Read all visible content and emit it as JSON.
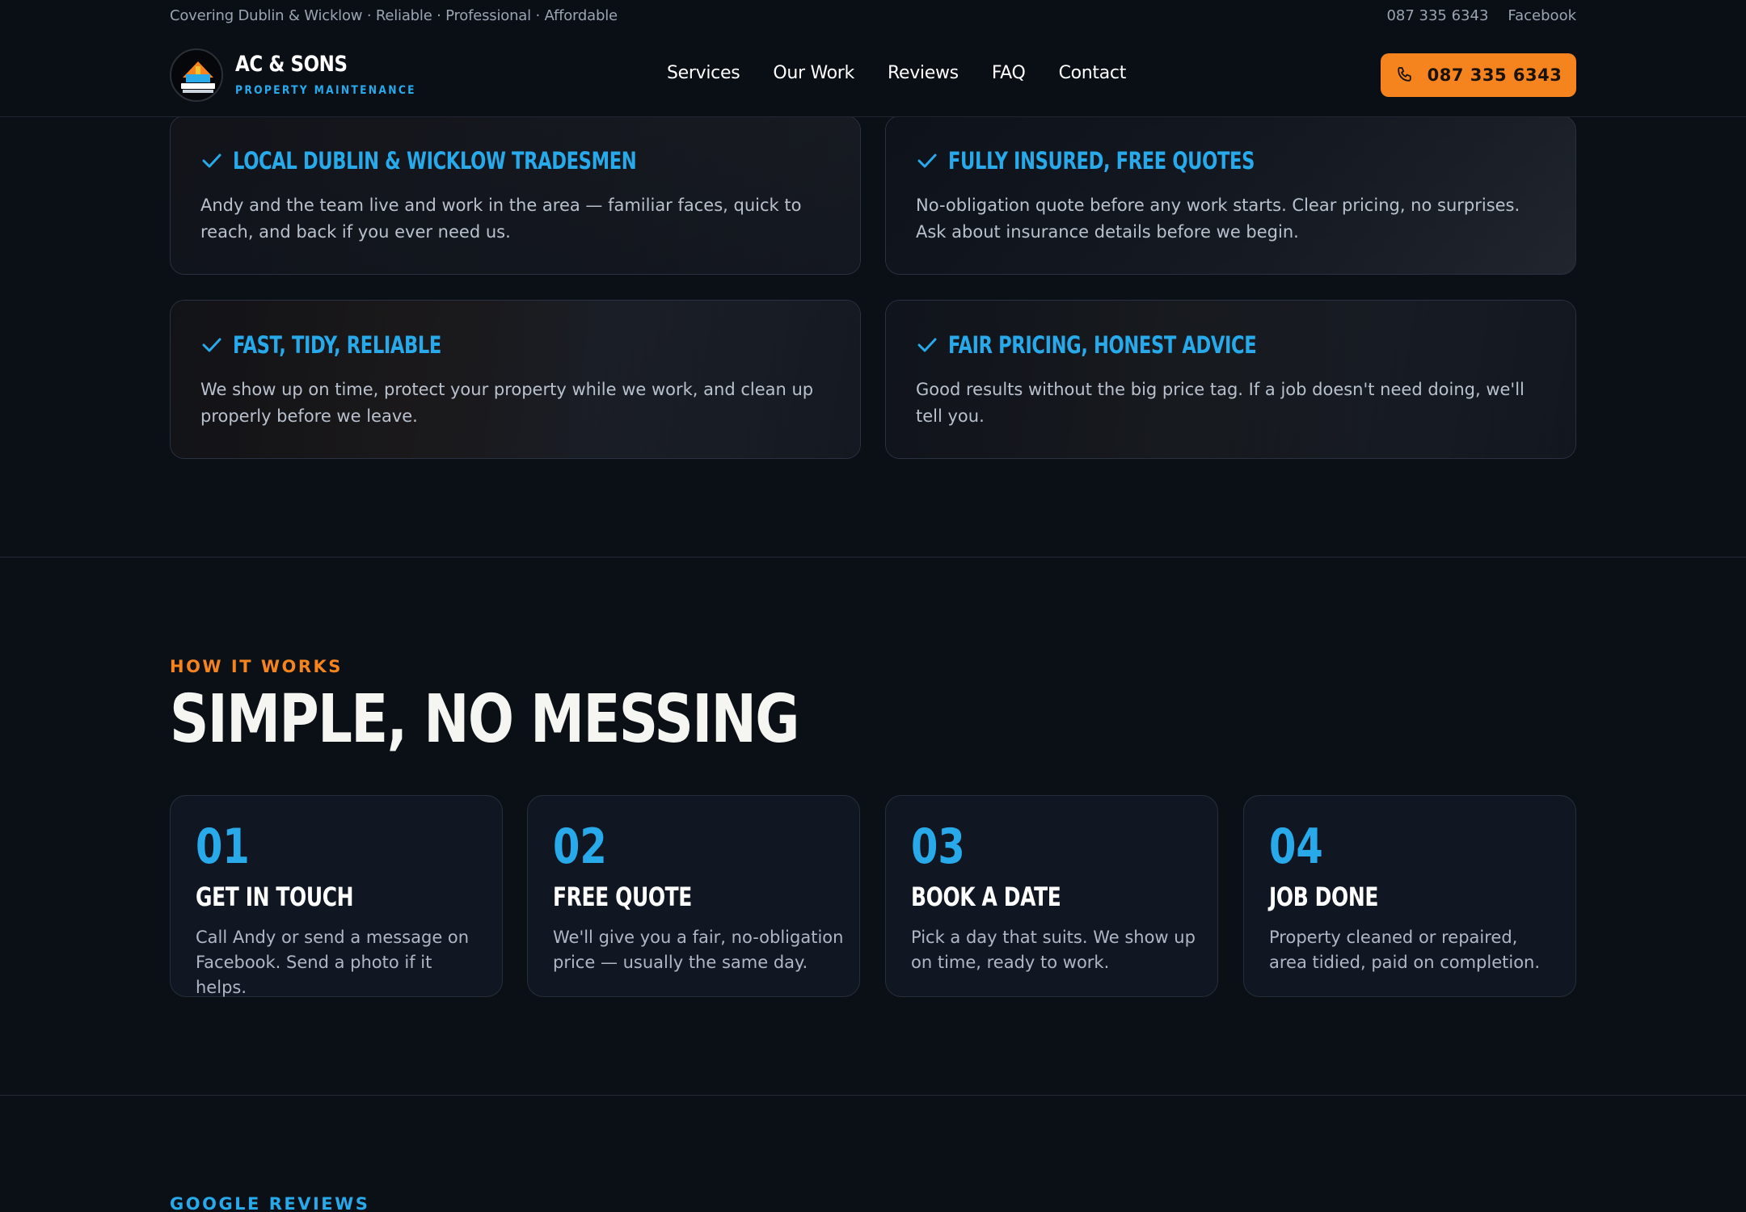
{
  "topbar": {
    "tagline": "Covering Dublin & Wicklow · Reliable · Professional · Affordable",
    "phone": "087 335 6343",
    "facebook": "Facebook"
  },
  "header": {
    "brand_name": "AC & SONS",
    "brand_sub": "PROPERTY MAINTENANCE",
    "nav": [
      "Services",
      "Our Work",
      "Reviews",
      "FAQ",
      "Contact"
    ],
    "call_button": "087 335 6343"
  },
  "features": [
    {
      "title": "LOCAL DUBLIN & WICKLOW TRADESMEN",
      "desc": "Andy and the team live and work in the area — familiar faces, quick to reach, and back if you ever need us."
    },
    {
      "title": "FULLY INSURED, FREE QUOTES",
      "desc": "No-obligation quote before any work starts. Clear pricing, no surprises. Ask about insurance details before we begin."
    },
    {
      "title": "FAST, TIDY, RELIABLE",
      "desc": "We show up on time, protect your property while we work, and clean up properly before we leave."
    },
    {
      "title": "FAIR PRICING, HONEST ADVICE",
      "desc": "Good results without the big price tag. If a job doesn't need doing, we'll tell you."
    }
  ],
  "how_it_works": {
    "eyebrow": "HOW IT WORKS",
    "title": "SIMPLE, NO MESSING",
    "steps": [
      {
        "num": "01",
        "title": "GET IN TOUCH",
        "desc": "Call Andy or send a message on Facebook. Send a photo if it helps."
      },
      {
        "num": "02",
        "title": "FREE QUOTE",
        "desc": "We'll give you a fair, no-obligation price — usually the same day."
      },
      {
        "num": "03",
        "title": "BOOK A DATE",
        "desc": "Pick a day that suits. We show up on time, ready to work."
      },
      {
        "num": "04",
        "title": "JOB DONE",
        "desc": "Property cleaned or repaired, area tidied, paid on completion."
      }
    ]
  },
  "reviews": {
    "eyebrow": "GOOGLE REVIEWS"
  },
  "colors": {
    "accent_blue": "#27a9ea",
    "accent_orange": "#f5841f",
    "background": "#0b0f16"
  },
  "icons": {
    "check": "check-icon",
    "phone": "phone-icon"
  }
}
